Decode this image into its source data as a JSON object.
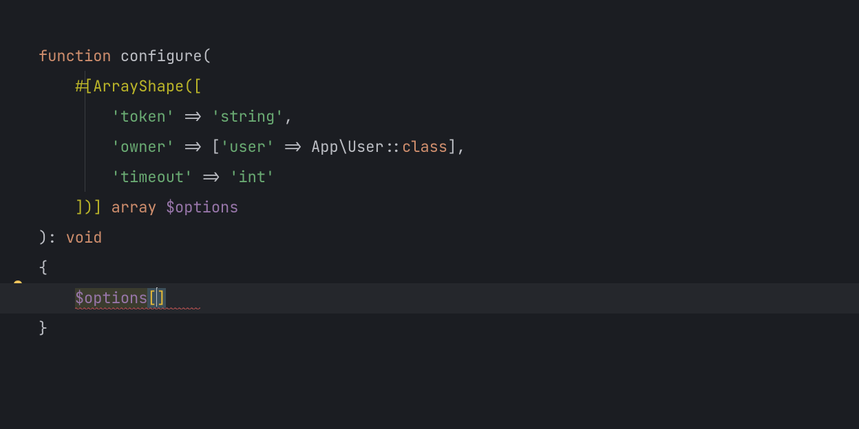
{
  "code": {
    "l1": {
      "kw": "function",
      "fn": "configure",
      "paren": "("
    },
    "l2": {
      "attr_open": "#[",
      "attr_name": "ArrayShape",
      "attr_paren": "(",
      "attr_brk": "["
    },
    "l3": {
      "key": "'token'",
      "arrow": "=>",
      "val": "'string'",
      "comma": ","
    },
    "l4": {
      "key": "'owner'",
      "arrow": "=>",
      "brk_open": "[",
      "inner_key": "'user'",
      "inner_arrow": "=>",
      "ns": "App\\User",
      "dbl": "::",
      "cls": "class",
      "brk_close": "]",
      "comma": ","
    },
    "l5": {
      "key": "'timeout'",
      "arrow": "=>",
      "val": "'int'"
    },
    "l6": {
      "attr_close": "])]",
      "type_kw": "array",
      "var": "$options"
    },
    "l7": {
      "paren_close": ")",
      "colon": ":",
      "ret": "void"
    },
    "l8": {
      "brace": "{"
    },
    "l9": {
      "var": "$options",
      "brk_open": "[",
      "brk_close": "]"
    },
    "l10": {
      "brace": "}"
    }
  },
  "icons": {
    "bulb": "lightbulb-icon"
  }
}
